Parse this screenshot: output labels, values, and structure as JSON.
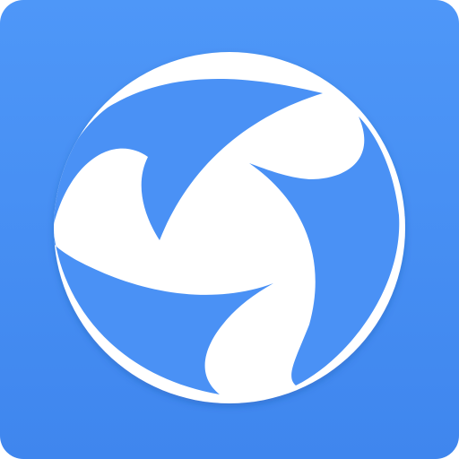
{
  "icon": {
    "name": "three-people-circle-logo-icon",
    "colors": {
      "tile_top": "#4E97F8",
      "tile_bottom": "#3F86EE",
      "glyph": "#FFFFFF"
    }
  }
}
